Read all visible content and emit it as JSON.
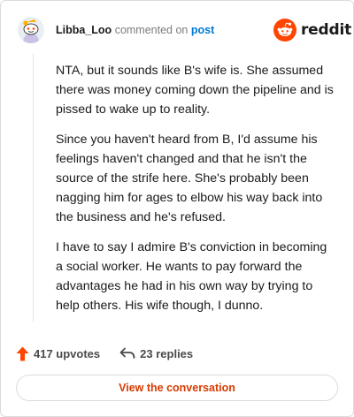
{
  "header": {
    "username": "Libba_Loo",
    "action_text": "commented on",
    "post_link": "post"
  },
  "brand": {
    "wordmark": "reddit",
    "accent_color": "#ff4500"
  },
  "comment": {
    "paragraphs": [
      "NTA, but it sounds like B's wife is. She assumed there was money coming down the pipeline and is pissed to wake up to reality.",
      "Since you haven't heard from B, I'd assume his feelings haven't changed and that he isn't the source of the strife here. She's probably been nagging him for ages to elbow his way back into the business and he's refused.",
      "I have to say I admire B's conviction in becoming a social worker. He wants to pay forward the advantages he had in his own way by trying to help others. His wife though, I dunno."
    ]
  },
  "stats": {
    "upvotes": "417 upvotes",
    "replies": "23 replies",
    "upvote_icon": "upvote-arrow-icon",
    "reply_icon": "reply-arrow-icon"
  },
  "actions": {
    "view_conversation": "View the conversation"
  }
}
